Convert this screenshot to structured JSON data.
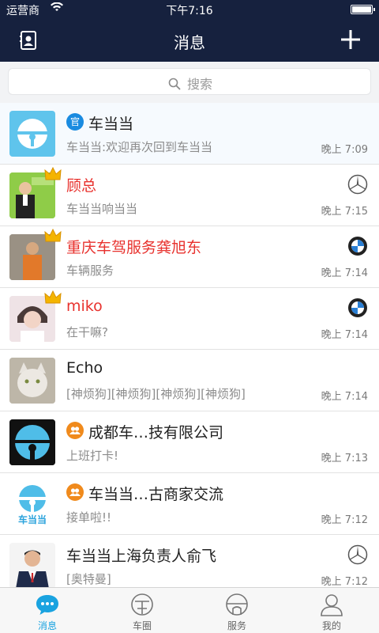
{
  "status_bar": {
    "carrier": "运营商",
    "time": "下午7:16"
  },
  "nav": {
    "title": "消息"
  },
  "search": {
    "placeholder": "搜索"
  },
  "conversations": [
    {
      "name": "车当当",
      "preview": "车当当:欢迎再次回到车当当",
      "time": "晚上 7:09",
      "badge": "官",
      "badge_color": "#1a8be0",
      "name_color": "#222222",
      "avatar": "chedangdang-logo-blue",
      "active": true
    },
    {
      "name": "顾总",
      "preview": "车当当响当当",
      "time": "晚上 7:15",
      "crown": true,
      "brand_icon": "mercedes-icon",
      "name_color": "#e8322e",
      "avatar": "man-standing-photo"
    },
    {
      "name": "重庆车驾服务龚旭东",
      "preview": "车辆服务",
      "time": "晚上 7:14",
      "crown": true,
      "brand_icon": "bmw-icon",
      "name_color": "#e8322e",
      "avatar": "man-orange-jacket-photo"
    },
    {
      "name": "miko",
      "preview": "在干嘛?",
      "time": "晚上 7:14",
      "crown": true,
      "brand_icon": "bmw-icon",
      "name_color": "#e8322e",
      "avatar": "young-man-photo"
    },
    {
      "name": "Echo",
      "preview": "[神烦狗][神烦狗][神烦狗][神烦狗]",
      "time": "晚上 7:14",
      "name_color": "#222222",
      "avatar": "cat-photo"
    },
    {
      "name": "成都车…技有限公司",
      "preview": "上班打卡!",
      "time": "晚上 7:13",
      "badge": "group-icon",
      "badge_color": "#f08a1c",
      "name_color": "#222222",
      "avatar": "chedangdang-logo-dark"
    },
    {
      "name": "车当当…古商家交流",
      "preview": "接单啦!!",
      "time": "晚上 7:12",
      "badge": "group-icon",
      "badge_color": "#f08a1c",
      "name_color": "#222222",
      "avatar": "chedangdang-logo-text",
      "avatar_text": "车当当"
    },
    {
      "name": "车当当上海负责人俞飞",
      "preview": "[奥特曼]",
      "time": "晚上 7:12",
      "brand_icon": "mercedes-icon",
      "name_color": "#222222",
      "avatar": "man-suit-photo"
    }
  ],
  "tabs": [
    {
      "label": "消息",
      "icon": "chat-bubble-icon",
      "active": true
    },
    {
      "label": "车圈",
      "icon": "circle-icon"
    },
    {
      "label": "服务",
      "icon": "service-icon"
    },
    {
      "label": "我的",
      "icon": "person-icon"
    }
  ],
  "colors": {
    "nav_bg": "#16213e",
    "accent": "#1aa3e0",
    "name_red": "#e8322e",
    "group_orange": "#f08a1c",
    "official_blue": "#1a8be0"
  }
}
